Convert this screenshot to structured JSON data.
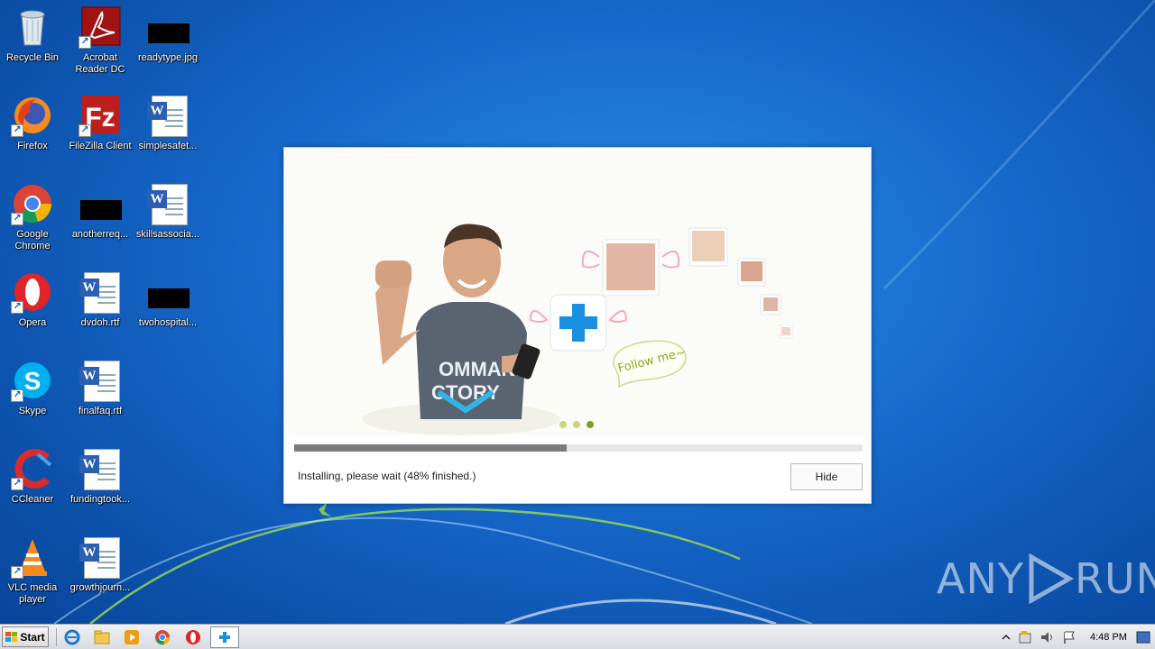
{
  "desktop": {
    "icons": [
      {
        "label": "Recycle Bin"
      },
      {
        "label": "Acrobat Reader DC"
      },
      {
        "label": "readytype.jpg"
      },
      {
        "label": "Firefox"
      },
      {
        "label": "FileZilla Client"
      },
      {
        "label": "simplesafet..."
      },
      {
        "label": "Google Chrome"
      },
      {
        "label": "anotherreq..."
      },
      {
        "label": "skillsassocia..."
      },
      {
        "label": "Opera"
      },
      {
        "label": "dvdoh.rtf"
      },
      {
        "label": "twohospital..."
      },
      {
        "label": "Skype"
      },
      {
        "label": "finalfaq.rtf"
      },
      {
        "label": "CCleaner"
      },
      {
        "label": "fundingtook..."
      },
      {
        "label": "VLC media player"
      },
      {
        "label": "growthjourn..."
      }
    ]
  },
  "installer": {
    "banner_bubble": "Follow me~",
    "banner_shirt_line1": "OMMAND",
    "banner_shirt_line2": "CTORY",
    "progress_percent": 48,
    "status": "Installing, please wait (48% finished.)",
    "hide_label": "Hide",
    "slide_count": 3,
    "active_slide": 3
  },
  "watermark": {
    "text_left": "ANY",
    "text_right": "RUN"
  },
  "taskbar": {
    "start_label": "Start",
    "clock": "4:48 PM"
  },
  "colors": {
    "accent_blue": "#1a8fe0",
    "progress_fill": "#7b7b7b",
    "dot_active": "#7aa21e",
    "dot_inactive": "#c7d77a"
  }
}
